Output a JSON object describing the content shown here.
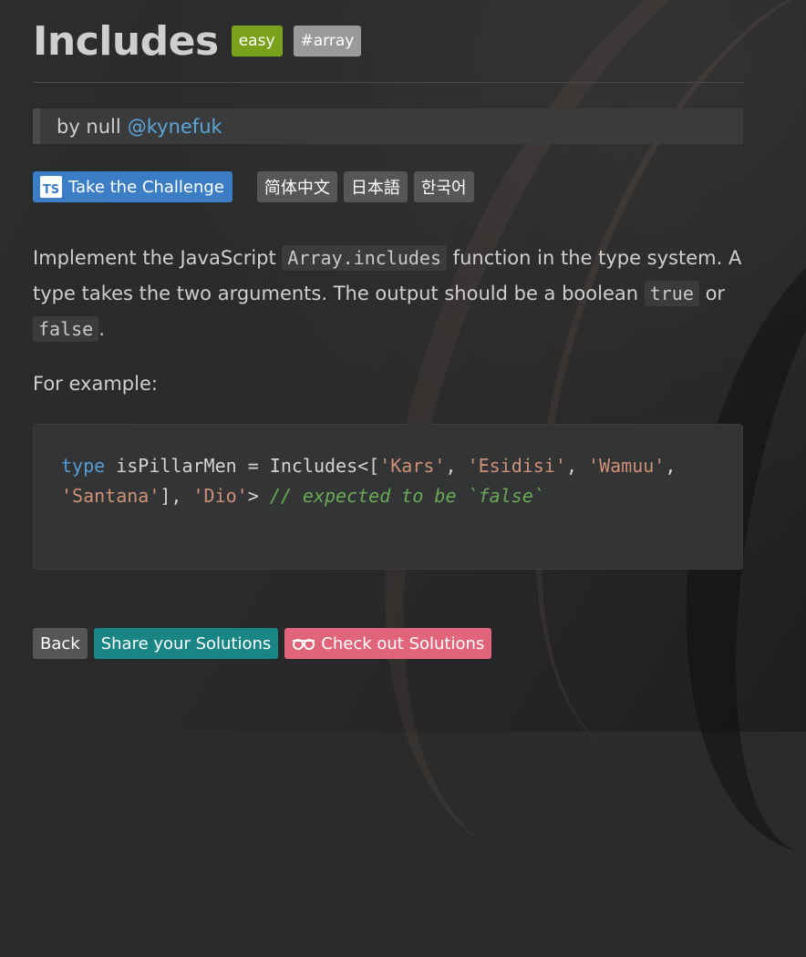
{
  "header": {
    "title": "Includes",
    "difficulty_badge": "easy",
    "tag_badge": "#array"
  },
  "author": {
    "by_text": "by null",
    "handle": "@kynefuk"
  },
  "challenge_buttons": {
    "ts_icon_text": "TS",
    "take_label": "Take the Challenge",
    "languages": [
      "简体中文",
      "日本語",
      "한국어"
    ]
  },
  "description": {
    "part1": "Implement the JavaScript ",
    "code1": "Array.includes",
    "part2": " function in the type system. A type takes the two arguments. The output should be a boolean ",
    "code2": "true",
    "part3": " or ",
    "code3": "false",
    "part4": "."
  },
  "example": {
    "label": "For example:",
    "code": {
      "kw": "type",
      "name": " isPillarMen = ",
      "generic": "Includes<[",
      "s1": "'Kars'",
      "sep1": ", ",
      "s2": "'Esidisi'",
      "sep2": ", ",
      "s3": "'Wamuu'",
      "sep3": ", ",
      "s4": "'Santana'",
      "close1": "], ",
      "s5": "'Dio'",
      "close2": "> ",
      "comment": "// expected to be `false`"
    }
  },
  "actions": {
    "back": "Back",
    "share": "Share your Solutions",
    "check": "Check out Solutions"
  },
  "colors": {
    "easy_badge": "#7aa11a",
    "ts_button": "#3b7ec6",
    "share_button": "#1a8585",
    "check_button": "#e0657a",
    "link": "#5aa6d6"
  }
}
